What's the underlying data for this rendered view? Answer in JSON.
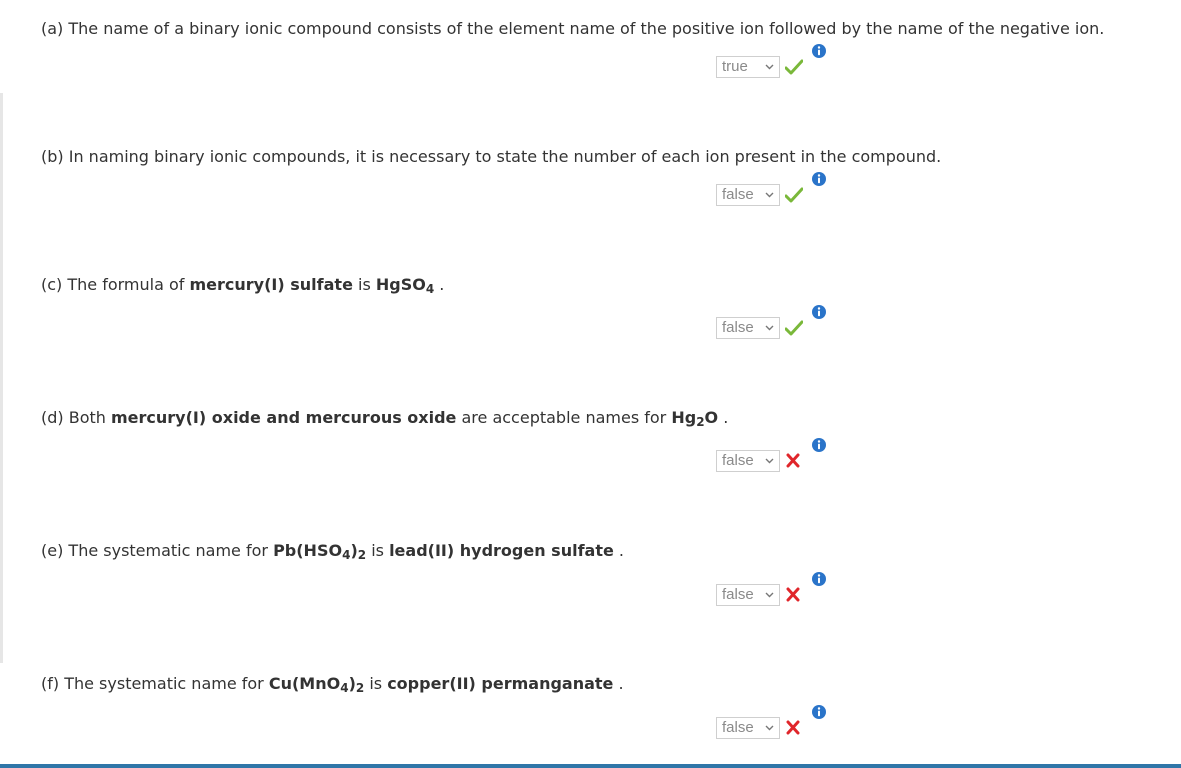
{
  "questions": [
    {
      "id": "a",
      "parts": [
        "(a) The name of a binary ionic compound consists of the element name of the positive ion followed by the name of the negative ion."
      ],
      "answer": "true",
      "correct": true
    },
    {
      "id": "b",
      "parts": [
        "(b) In naming binary ionic compounds, it is necessary to state the number of each ion present in the compound."
      ],
      "answer": "false",
      "correct": true
    },
    {
      "id": "c",
      "prefix": "(c) The formula of ",
      "bold1": "mercury(I) sulfate",
      "mid": " is ",
      "formula_main": "HgSO",
      "formula_sub": "4",
      "suffix": " .",
      "answer": "false",
      "correct": true
    },
    {
      "id": "d",
      "prefix": "(d) Both ",
      "bold1": "mercury(I) oxide and mercurous oxide",
      "mid": " are acceptable names for ",
      "formula_main": "Hg",
      "formula_sub": "2",
      "formula_tail": "O",
      "suffix": " .",
      "answer": "false",
      "correct": false
    },
    {
      "id": "e",
      "prefix": "(e) The systematic name for ",
      "formula_a": "Pb(HSO",
      "formula_a_sub": "4",
      "formula_b": ")",
      "formula_b_sub": "2",
      "mid": " is ",
      "bold2": "lead(II) hydrogen sulfate",
      "suffix": " .",
      "answer": "false",
      "correct": false
    },
    {
      "id": "f",
      "prefix": "(f) The systematic name for ",
      "formula_a": "Cu(MnO",
      "formula_a_sub": "4",
      "formula_b": ")",
      "formula_b_sub": "2",
      "mid": " is ",
      "bold2": "copper(II) permanganate",
      "suffix": " .",
      "answer": "false",
      "correct": false
    }
  ],
  "icons": {
    "correct": "check-icon",
    "incorrect": "x-icon",
    "info": "info-icon",
    "dropdown": "chevron-down-icon"
  },
  "colors": {
    "correct": "#7ab83a",
    "incorrect": "#e0262b",
    "info": "#2a74c9",
    "accent_bar": "#2f76a8"
  }
}
